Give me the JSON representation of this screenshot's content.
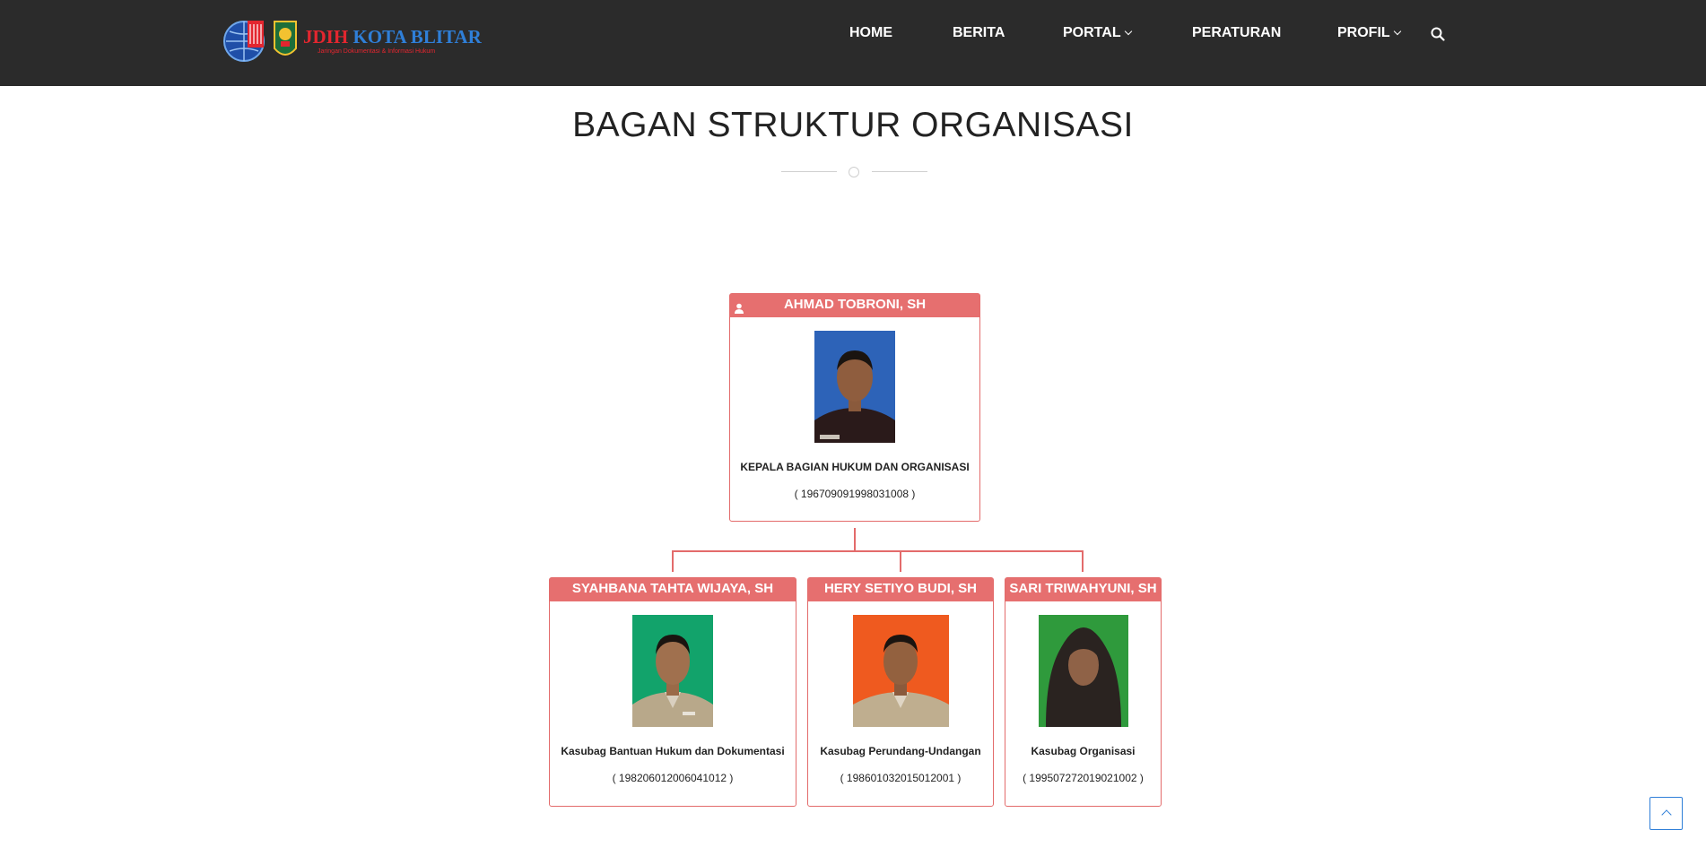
{
  "header": {
    "logo_title_part1": "JDIH",
    "logo_title_part2": "KOTA BLITAR",
    "logo_subtitle": "Jaringan Dokumentasi & Informasi Hukum",
    "nav": [
      {
        "label": "HOME",
        "has_dropdown": false
      },
      {
        "label": "BERITA",
        "has_dropdown": false
      },
      {
        "label": "PORTAL",
        "has_dropdown": true
      },
      {
        "label": "PERATURAN",
        "has_dropdown": false
      },
      {
        "label": "PROFIL",
        "has_dropdown": true
      }
    ],
    "search_icon": "search-icon"
  },
  "page": {
    "title": "BAGAN STRUKTUR ORGANISASI"
  },
  "org": {
    "head": {
      "name": "AHMAD TOBRONI, SH",
      "position": "KEPALA BAGIAN HUKUM DAN ORGANISASI",
      "nip": "( 196709091998031008 )",
      "photo_bg": "#2d63b8"
    },
    "members": [
      {
        "name": "SYAHBANA TAHTA WIJAYA, SH",
        "position": "Kasubag Bantuan Hukum dan Dokumentasi",
        "nip": "( 198206012006041012 )",
        "photo_bg": "#12a36b"
      },
      {
        "name": "HERY SETIYO BUDI, SH",
        "position": "Kasubag Perundang-Undangan",
        "nip": "( 198601032015012001 )",
        "photo_bg": "#ef5a1f"
      },
      {
        "name": "SARI TRIWAHYUNI, SH",
        "position": "Kasubag Organisasi",
        "nip": "( 199507272019021002 )",
        "photo_bg": "#2f9a3c"
      }
    ]
  },
  "colors": {
    "header_bg": "#2b2b2b",
    "accent_red": "#e66f6f",
    "accent_blue": "#2f7fd8"
  }
}
